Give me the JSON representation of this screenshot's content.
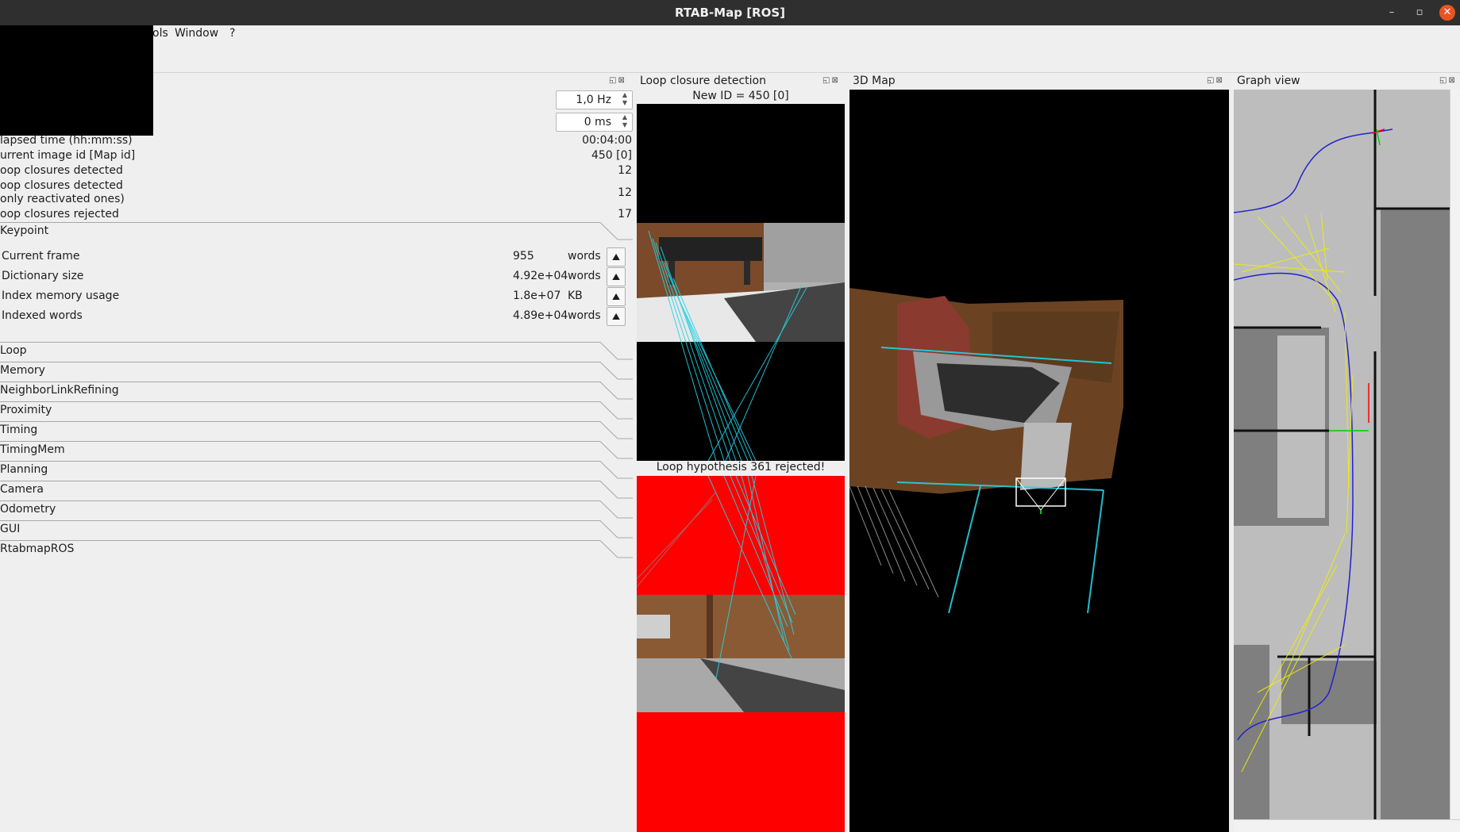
{
  "window": {
    "title": "RTAB-Map [ROS]",
    "min_glyph": "–",
    "max_glyph": "▫",
    "close_glyph": "✕"
  },
  "menu": {
    "items": [
      "ols",
      "Window",
      "?"
    ]
  },
  "docks": {
    "stats_buttons": "◱⊠",
    "loop_title": "Loop closure detection",
    "loop_buttons": "◱⊠",
    "map3d_title": "3D Map",
    "map3d_buttons": "◱⊠",
    "graph_title": "Graph view",
    "graph_buttons": "◱⊠"
  },
  "stats_panel": {
    "rate_value": "1,0 Hz",
    "time_limit_value": "0 ms",
    "spin_up": "▲",
    "spin_down": "▼",
    "rows": [
      {
        "label": "lapsed time (hh:mm:ss)",
        "value": "00:04:00"
      },
      {
        "label": "urrent image id [Map id]",
        "value": "450 [0]"
      },
      {
        "label": "oop closures detected",
        "value": "12"
      },
      {
        "label": "oop closures detected\nonly reactivated ones)",
        "value": "12"
      },
      {
        "label": "oop closures rejected",
        "value": "17"
      }
    ],
    "keypoint": {
      "title": "Keypoint",
      "rows": [
        {
          "name": "Current frame",
          "value": "955",
          "unit": "words"
        },
        {
          "name": "Dictionary size",
          "value": "4.92e+04",
          "unit": "words"
        },
        {
          "name": "Index memory usage",
          "value": "1.8e+07",
          "unit": "KB"
        },
        {
          "name": "Indexed words",
          "value": "4.89e+04",
          "unit": "words"
        }
      ],
      "plot_button_glyph": "⛰"
    },
    "sections": [
      "Loop",
      "Memory",
      "NeighborLinkRefining",
      "Proximity",
      "Timing",
      "TimingMem",
      "Planning",
      "Camera",
      "Odometry",
      "GUI",
      "RtabmapROS"
    ]
  },
  "loop_panel": {
    "new_id_text": "New ID = 450 [0]",
    "hypothesis_text": "Loop hypothesis 361 rejected!"
  },
  "colors": {
    "rejected_red": "#ff0000",
    "match_cyan": "#22d3e6",
    "path_blue": "#2222cc",
    "link_yellow": "#f0f000",
    "close_orange": "#e95420"
  },
  "icons": {
    "minimize": "minimize-icon",
    "maximize": "maximize-icon",
    "close": "close-icon",
    "plot": "plot-icon",
    "collapse": "section-chevron-icon"
  }
}
